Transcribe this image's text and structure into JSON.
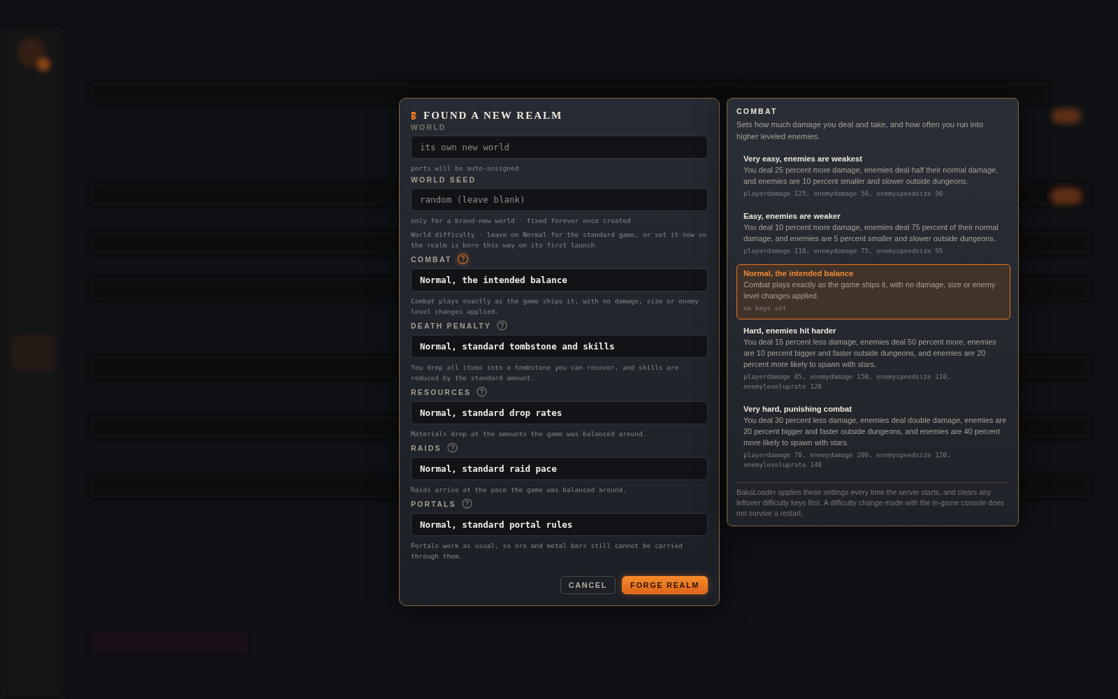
{
  "dialog": {
    "title": "FOUND A NEW REALM",
    "fields": [
      {
        "label": "WORLD",
        "placeholder": "its own new world",
        "hint": "ports will be auto-assigned"
      },
      {
        "label": "WORLD SEED",
        "placeholder": "random (leave blank)",
        "hint": "only for a brand-new world · fixed forever once created"
      }
    ],
    "note": "World difficulty · leave on Normal for the standard game, or set it now so the realm is born this way on its first launch",
    "settings": [
      {
        "label": "COMBAT",
        "help_selected": true,
        "value": "Normal, the intended balance",
        "description": "Combat plays exactly as the game ships it, with no damage, size or enemy level changes applied."
      },
      {
        "label": "DEATH PENALTY",
        "help_selected": false,
        "value": "Normal, standard tombstone and skills",
        "description": "You drop all items into a tombstone you can recover, and skills are reduced by the standard amount."
      },
      {
        "label": "RESOURCES",
        "help_selected": false,
        "value": "Normal, standard drop rates",
        "description": "Materials drop at the amounts the game was balanced around."
      },
      {
        "label": "RAIDS",
        "help_selected": false,
        "value": "Normal, standard raid pace",
        "description": "Raids arrive at the pace the game was balanced around."
      },
      {
        "label": "PORTALS",
        "help_selected": false,
        "value": "Normal, standard portal rules",
        "description": "Portals work as usual, so ore and metal bars still cannot be carried through them."
      }
    ],
    "buttons": [
      {
        "label": "CANCEL",
        "kind": "secondary"
      },
      {
        "label": "FORGE REALM",
        "kind": "primary"
      }
    ]
  },
  "help_panel": {
    "title": "COMBAT",
    "intro": "Sets how much damage you deal and take, and how often you run into higher leveled enemies.",
    "options": [
      {
        "title": "Very easy, enemies are weakest",
        "description": "You deal 25 percent more damage, enemies deal half their normal damage, and enemies are 10 percent smaller and slower outside dungeons.",
        "keys": "playerdamage 125, enemydamage 50, enemyspeedsize 90",
        "selected": false
      },
      {
        "title": "Easy, enemies are weaker",
        "description": "You deal 10 percent more damage, enemies deal 75 percent of their normal damage, and enemies are 5 percent smaller and slower outside dungeons.",
        "keys": "playerdamage 110, enemydamage 75, enemyspeedsize 95",
        "selected": false
      },
      {
        "title": "Normal, the intended balance",
        "description": "Combat plays exactly as the game ships it, with no damage, size or enemy level changes applied.",
        "keys": "no keys set",
        "selected": true
      },
      {
        "title": "Hard, enemies hit harder",
        "description": "You deal 15 percent less damage, enemies deal 50 percent more, enemies are 10 percent bigger and faster outside dungeons, and enemies are 20 percent more likely to spawn with stars.",
        "keys": "playerdamage 85, enemydamage 150, enemyspeedsize 110, enemyleveluprate 120",
        "selected": false
      },
      {
        "title": "Very hard, punishing combat",
        "description": "You deal 30 percent less damage, enemies deal double damage, enemies are 20 percent bigger and faster outside dungeons, and enemies are 40 percent more likely to spawn with stars.",
        "keys": "playerdamage 70, enemydamage 200, enemyspeedsize 120, enemyleveluprate 140",
        "selected": false
      }
    ],
    "footer": "BakaLoader applies these settings every time the server starts, and clears any leftover difficulty keys first. A difficulty change made with the in-game console does not survive a restart."
  }
}
